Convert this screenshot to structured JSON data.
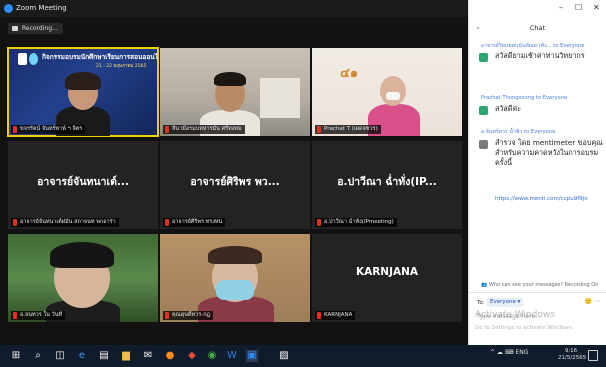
{
  "window": {
    "title": "Zoom Meeting",
    "recording_label": "Recording..."
  },
  "tiles": [
    {
      "banner_title": "กิจกรรมอบรมนักศึกษาเรียนการสอนออนไลน์",
      "banner_sub": "21 - 22  พฤษภาคม 2565",
      "name": "ขจรรัตน์ จันทร์ทาพ์ ฯ จิตร"
    },
    {
      "name": "ลีนามีอรมบทหารมัน ศรีทงทม"
    },
    {
      "name": "Prachat T (เผดจชวร)"
    },
    {
      "big_name": "อาจารย์จันทนาเต์...",
      "name": "อาจารย์จันทนาเต์ฝมัน สถาจนท พกอาร่า"
    },
    {
      "big_name": "อาจารย์ศิริพร พว...",
      "name": "อาจารย์ศิริพร ทรงทน"
    },
    {
      "big_name": "อ.ปาวีณา ฉ่ำทั่ง(IP...",
      "name": "อ.ปาวีณา ฉ่ำทั่ง(IPmeeting)"
    },
    {
      "name": "อ.จนทวร ใน วันที่"
    },
    {
      "name": "คุณดุษดิ์ทวร-กฎ"
    },
    {
      "big_name": "KARNJANA",
      "name": "KARNJANA"
    }
  ],
  "chat": {
    "title": "Chat",
    "window_controls": [
      "–",
      "☐",
      "✕"
    ],
    "collapse_icon": "⌄",
    "messages": [
      {
        "header": "อาจารย์วิทแยทแน้นทัณท (ท้ง...  to Everyone",
        "text": "สวัสดียามเช้าค่าท่านวิทยากร",
        "avatar_color": "#2aa873"
      },
      {
        "header": "Prachat Thongsoong to Everyone",
        "text": "สวัสดีค่ะ",
        "avatar_color": "#2aa873"
      },
      {
        "header": "อ.จันทร์ทวร น้ำฟ้า   to Everyone",
        "text": "สำรวจ โดย mentimeter ขอบคุณ สำหรับความคาดหวังในการอบรมครั้งนี้",
        "link": "https://www.menti.com/ccpu9f9jo",
        "avatar_color": "#7a7a7a"
      }
    ],
    "who_can_see_icon": "👥",
    "who_can_see": "Who can see your messages? Recording On",
    "to_label": "To:",
    "to_value": "Everyone ▾",
    "compose_icons": "🙂 ⋯",
    "placeholder": "Type message here...",
    "watermark_title": "Activate Windows",
    "watermark_sub": "Go to Settings to activate Windows."
  },
  "taskbar": {
    "tray_text": "^  ☁  ⌨  ENG",
    "time": "9:16",
    "date": "21/5/2565"
  }
}
